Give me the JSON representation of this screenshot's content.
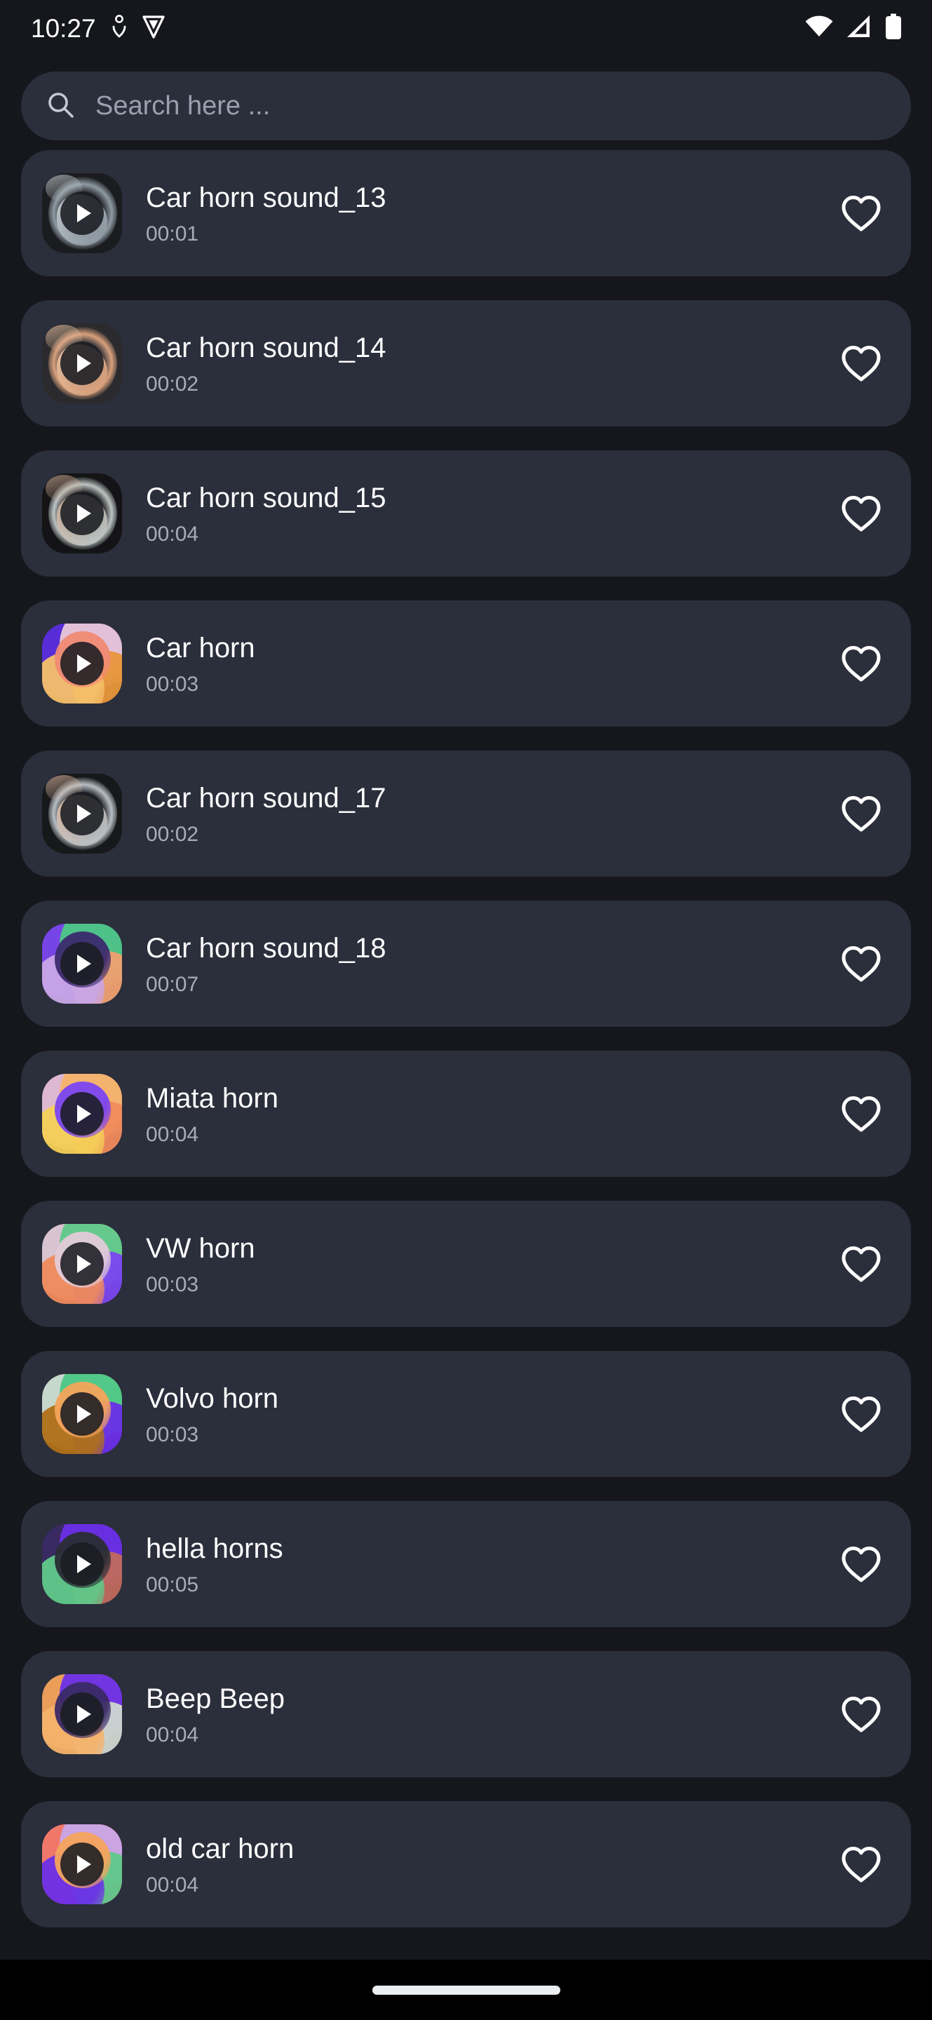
{
  "status_bar": {
    "clock": "10:27",
    "left_icons": [
      "person-shield-icon",
      "vpn-key-icon"
    ],
    "right_icons": [
      "wifi-icon",
      "cellular-signal-icon",
      "battery-icon"
    ]
  },
  "search": {
    "placeholder": "Search here ...",
    "value": "",
    "icon": "search-icon"
  },
  "list": {
    "favorite_icon": "heart-outline-icon",
    "play_icon": "play-icon",
    "items": [
      {
        "title": "Car horn sound_13",
        "duration": "00:01",
        "thumb_kind": "photo",
        "thumb_name": "steering-wheel-photo",
        "colors": [
          "#1b1c1f",
          "#8f9aa3",
          "#cfd6da",
          "#2a2c30"
        ]
      },
      {
        "title": "Car horn sound_14",
        "duration": "00:02",
        "thumb_kind": "photo",
        "thumb_name": "hand-on-horn-illustration",
        "colors": [
          "#2b2b2e",
          "#d8a07c",
          "#efc7a6",
          "#3a3a3e"
        ]
      },
      {
        "title": "Car horn sound_15",
        "duration": "00:04",
        "thumb_kind": "photo",
        "thumb_name": "hand-on-steering-wheel-photo",
        "colors": [
          "#141416",
          "#bcc4c2",
          "#d8b39a",
          "#232326"
        ]
      },
      {
        "title": "Car horn",
        "duration": "00:03",
        "thumb_kind": "gradient",
        "thumb_name": "abstract-gradient-artwork",
        "colors": [
          "#e8963a",
          "#f6c06a",
          "#f08a74",
          "#5b2de0",
          "#e9c9d8",
          "#24272f"
        ]
      },
      {
        "title": "Car horn sound_17",
        "duration": "00:02",
        "thumb_kind": "photo",
        "thumb_name": "hands-on-steering-wheel-photo",
        "colors": [
          "#17181a",
          "#b8bfc4",
          "#e4bda6",
          "#2c2e33"
        ]
      },
      {
        "title": "Car horn sound_18",
        "duration": "00:07",
        "thumb_kind": "gradient",
        "thumb_name": "abstract-gradient-artwork",
        "colors": [
          "#7b45f0",
          "#4cc884",
          "#f0a070",
          "#c9a6e8",
          "#3b2a6e",
          "#24272f"
        ]
      },
      {
        "title": "Miata horn",
        "duration": "00:04",
        "thumb_kind": "gradient",
        "thumb_name": "abstract-gradient-artwork",
        "colors": [
          "#7b45f0",
          "#e8c0d8",
          "#f5b26a",
          "#f08a5c",
          "#f5cf57",
          "#24272f"
        ]
      },
      {
        "title": "VW horn",
        "duration": "00:03",
        "thumb_kind": "gradient",
        "thumb_name": "abstract-gradient-artwork",
        "colors": [
          "#5fc98a",
          "#7b45f0",
          "#f08a5c",
          "#e2cbd8",
          "#24272f"
        ]
      },
      {
        "title": "Volvo horn",
        "duration": "00:03",
        "thumb_kind": "gradient",
        "thumb_name": "abstract-gradient-artwork",
        "colors": [
          "#6b2fe8",
          "#b07018",
          "#f5a45c",
          "#cfe0d4",
          "#4cc884",
          "#24272f"
        ]
      },
      {
        "title": "hella horns",
        "duration": "00:05",
        "thumb_kind": "gradient",
        "thumb_name": "abstract-gradient-artwork",
        "colors": [
          "#6b2fe8",
          "#c06a5c",
          "#5fc98a",
          "#2a2d35",
          "#3a2a66",
          "#24272f"
        ]
      },
      {
        "title": "Beep Beep",
        "duration": "00:04",
        "thumb_kind": "gradient",
        "thumb_name": "abstract-gradient-artwork",
        "colors": [
          "#f5a45c",
          "#6b2fe8",
          "#cfd8d0",
          "#f5b26a",
          "#3a2a66",
          "#24272f"
        ]
      },
      {
        "title": "old car horn",
        "duration": "00:04",
        "thumb_kind": "gradient",
        "thumb_name": "abstract-gradient-artwork",
        "colors": [
          "#f5a45c",
          "#f07a6a",
          "#c9a6e8",
          "#5fc98a",
          "#6b2fe8",
          "#ef4a7a"
        ]
      }
    ]
  },
  "nav_bar": {
    "gesture_pill": "home-gesture-pill"
  },
  "theme": {
    "background": "#15171c",
    "card": "#2b2e3b",
    "title_text": "#ffffff",
    "secondary_text": "#a7acb8",
    "placeholder_text": "#9aa0ae",
    "nav_background": "#000000"
  }
}
